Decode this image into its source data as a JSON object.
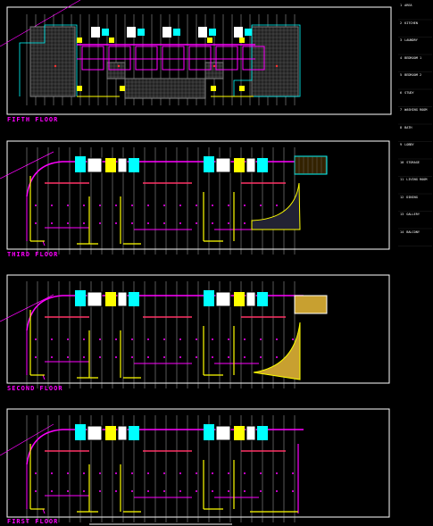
{
  "floors": [
    {
      "id": "fifth",
      "label": "FIFTH FLOOR"
    },
    {
      "id": "third",
      "label": "THIRD FLOOR"
    },
    {
      "id": "second",
      "label": "SECOND FLOOR"
    },
    {
      "id": "first",
      "label": "FIRST FLOOR"
    }
  ],
  "legend": [
    {
      "num": "1",
      "text": "AREA"
    },
    {
      "num": "2",
      "text": "KITCHEN"
    },
    {
      "num": "3",
      "text": "LAUNDRY"
    },
    {
      "num": "4",
      "text": "BEDROOM 1"
    },
    {
      "num": "5",
      "text": "BEDROOM 2"
    },
    {
      "num": "6",
      "text": "STUDY"
    },
    {
      "num": "7",
      "text": "WASHING ROOM"
    },
    {
      "num": "8",
      "text": "BATH"
    },
    {
      "num": "9",
      "text": "LOBBY"
    },
    {
      "num": "10",
      "text": "STORAGE"
    },
    {
      "num": "11",
      "text": "LIVING ROOM"
    },
    {
      "num": "12",
      "text": "DINING"
    },
    {
      "num": "13",
      "text": "GALLERY"
    },
    {
      "num": "14",
      "text": "BALCONY"
    }
  ],
  "colors": {
    "wall": "#ff00ff",
    "frame": "#ffffff",
    "column": "#ffff00",
    "accent": "#00ffff",
    "hatch": "#c8a030"
  }
}
